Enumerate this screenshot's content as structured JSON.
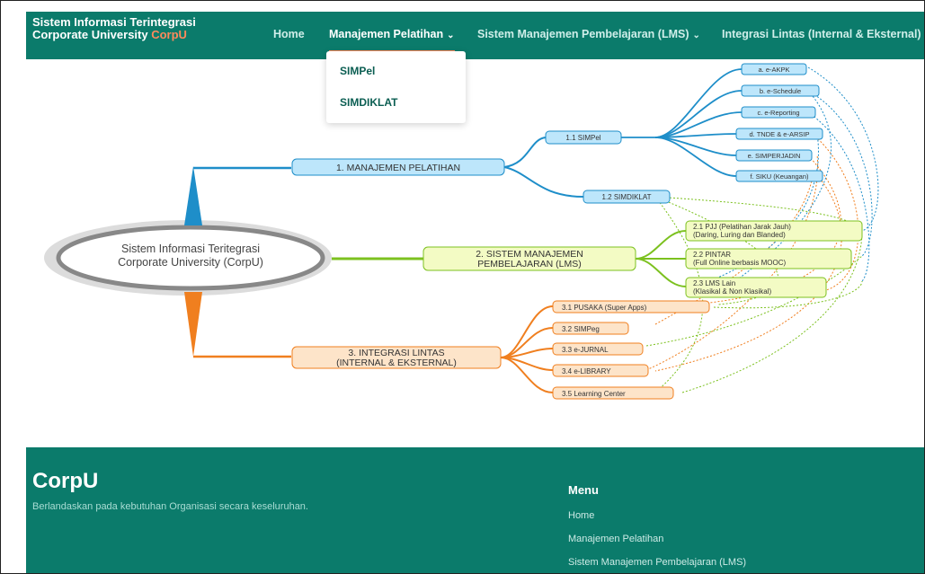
{
  "header": {
    "brand_line1": "Sistem Informasi Terintegrasi",
    "brand_line2_prefix": "Corporate University ",
    "brand_line2_accent": "CorpU",
    "nav": {
      "home": "Home",
      "manajemen": "Manajemen Pelatihan",
      "lms": "Sistem Manajemen Pembelajaran (LMS)",
      "integrasi": "Integrasi Lintas (Internal & Eksternal)"
    }
  },
  "dropdown": {
    "items": [
      "SIMPel",
      "SIMDIKLAT"
    ]
  },
  "mindmap": {
    "center_line1": "Sistem Informasi Teritegrasi",
    "center_line2": "Corporate University (CorpU)",
    "b1": {
      "label": "1. MANAJEMEN PELATIHAN",
      "s1": "1.1 SIMPel",
      "s2": "1.2 SIMDIKLAT",
      "leaves": [
        "a. e-AKPK",
        "b. e-Schedule",
        "c. e-Reporting",
        "d. TNDE & e-ARSIP",
        "e. SIMPERJADIN",
        "f. SIKU (Keuangan)"
      ]
    },
    "b2": {
      "label_line1": "2. SISTEM MANAJEMEN",
      "label_line2": "PEMBELAJARAN (LMS)",
      "l1a": "2.1 PJJ (Pelatihan Jarak Jauh)",
      "l1b": "(Daring, Luring dan Blanded)",
      "l2a": "2.2 PINTAR",
      "l2b": "(Full Online berbasis MOOC)",
      "l3a": "2.3 LMS Lain",
      "l3b": "(Klasikal & Non Klasikal)"
    },
    "b3": {
      "label_line1": "3. INTEGRASI LINTAS",
      "label_line2": "(INTERNAL & EKSTERNAL)",
      "leaves": [
        "3.1 PUSAKA (Super Apps)",
        "3.2 SIMPeg",
        "3.3 e-JURNAL",
        "3.4 e-LIBRARY",
        "3.5 Learning Center"
      ]
    },
    "colors": {
      "blue": "#1e8ec9",
      "green": "#7cc11f",
      "orange": "#f07f1f"
    }
  },
  "footer": {
    "title": "CorpU",
    "tagline": "Berlandaskan pada kebutuhan Organisasi secara keseluruhan.",
    "menu_title": "Menu",
    "links": [
      "Home",
      "Manajemen Pelatihan",
      "Sistem Manajemen Pembelajaran (LMS)"
    ]
  }
}
